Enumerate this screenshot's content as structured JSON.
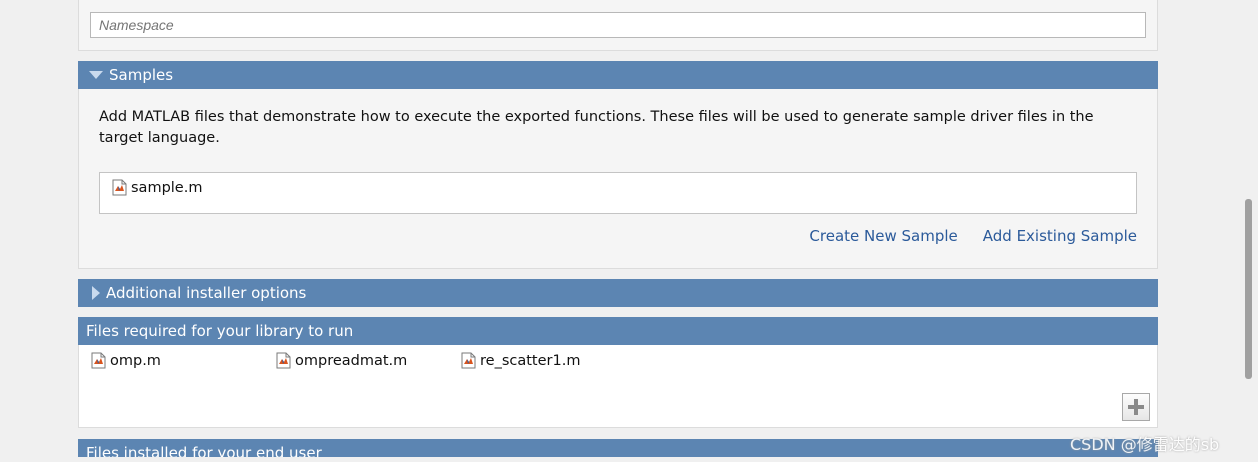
{
  "namespace": {
    "placeholder": "Namespace"
  },
  "samples": {
    "title": "Samples",
    "description": "Add MATLAB files that demonstrate how to execute the exported functions.  These files will be used to generate sample driver files in the target language.",
    "files": [
      "sample.m"
    ],
    "create_label": "Create New Sample",
    "add_label": "Add Existing Sample"
  },
  "installer": {
    "title": "Additional installer options"
  },
  "required": {
    "title": "Files required for your library to run",
    "files": [
      "omp.m",
      "ompreadmat.m",
      "re_scatter1.m"
    ]
  },
  "installed": {
    "title": "Files installed for your end user"
  },
  "watermark": "CSDN @修雷达的sb",
  "colors": {
    "header": "#5c85b2",
    "link": "#2b5a9a"
  }
}
